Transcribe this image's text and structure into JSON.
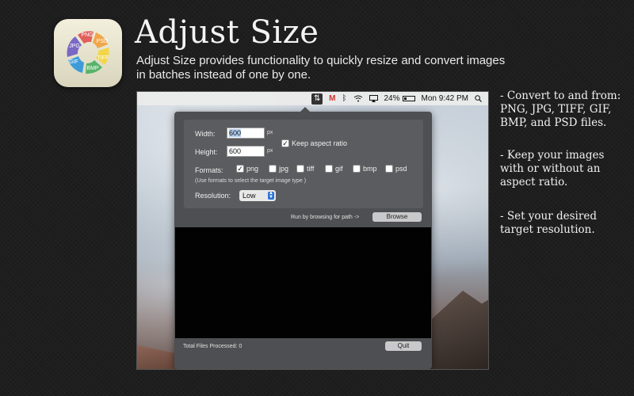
{
  "header": {
    "title": "Adjust Size",
    "description": "Adjust Size provides functionality to quickly resize and convert images in batches instead of one by one.",
    "icon_labels": [
      "PNG",
      "PSD",
      "TIFF",
      "BMP",
      "GIF",
      "JPG"
    ]
  },
  "menubar": {
    "battery": "24%",
    "clock": "Mon 9:42 PM",
    "app_glyph": "⇅",
    "red_glyph": "M"
  },
  "form": {
    "width_label": "Width:",
    "width_value": "600",
    "height_label": "Height:",
    "height_value": "600",
    "unit": "px",
    "keep_aspect_label": "Keep aspect ratio",
    "keep_aspect_checked": true,
    "formats_label": "Formats:",
    "formats": [
      {
        "label": "png",
        "checked": true
      },
      {
        "label": "jpg",
        "checked": false
      },
      {
        "label": "tiff",
        "checked": false
      },
      {
        "label": "gif",
        "checked": false
      },
      {
        "label": "bmp",
        "checked": false
      },
      {
        "label": "psd",
        "checked": false
      }
    ],
    "formats_hint": "(Use formats to select the target image type )",
    "resolution_label": "Resolution:",
    "resolution_value": "Low",
    "browse_hint": "Run by browsing for path ->",
    "browse_button": "Browse",
    "files_processed": "Total Files Processed: 0",
    "quit_button": "Quit"
  },
  "features": [
    "- Convert to and from: PNG, JPG, TIFF, GIF, BMP, and PSD files.",
    "- Keep your images with or without an aspect ratio.",
    "- Set your desired target resolution."
  ],
  "colors": {
    "background": "#1e1e1e",
    "panel": "#4e4f52",
    "accent_blue": "#2b74d8"
  }
}
